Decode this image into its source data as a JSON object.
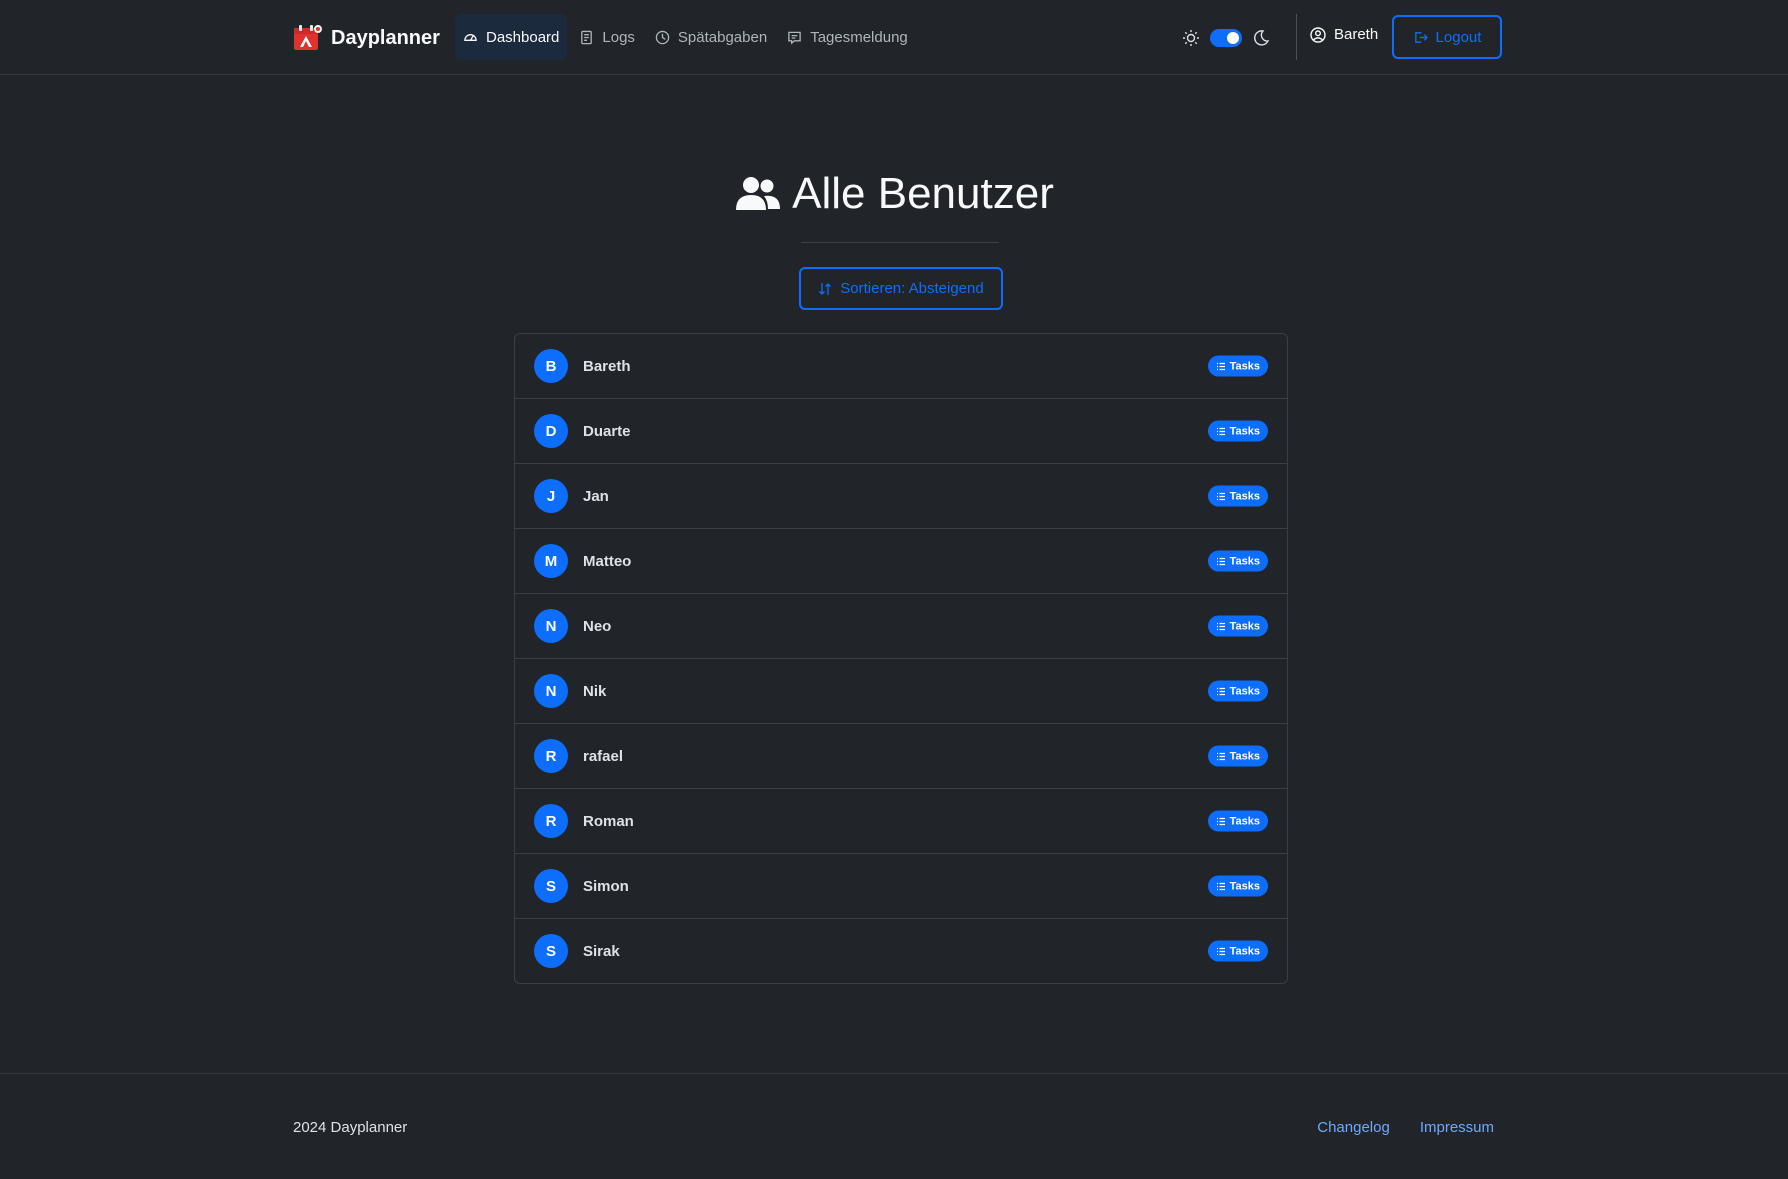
{
  "brand": {
    "name": "Dayplanner",
    "logo_icon": "calendar-logo-icon"
  },
  "nav": {
    "items": [
      {
        "label": "Dashboard",
        "icon": "speedometer-icon",
        "active": true
      },
      {
        "label": "Logs",
        "icon": "document-icon",
        "active": false
      },
      {
        "label": "Spätabgaben",
        "icon": "clock-icon",
        "active": false
      },
      {
        "label": "Tagesmeldung",
        "icon": "chat-icon",
        "active": false
      }
    ],
    "theme_dark_enabled": true,
    "user_name": "Bareth",
    "logout_label": "Logout"
  },
  "page": {
    "title": "Alle Benutzer",
    "sort_label": "Sortieren: Absteigend"
  },
  "users": [
    {
      "initial": "B",
      "name": "Bareth",
      "action": "Tasks"
    },
    {
      "initial": "D",
      "name": "Duarte",
      "action": "Tasks"
    },
    {
      "initial": "J",
      "name": "Jan",
      "action": "Tasks"
    },
    {
      "initial": "M",
      "name": "Matteo",
      "action": "Tasks"
    },
    {
      "initial": "N",
      "name": "Neo",
      "action": "Tasks"
    },
    {
      "initial": "N",
      "name": "Nik",
      "action": "Tasks"
    },
    {
      "initial": "R",
      "name": "rafael",
      "action": "Tasks"
    },
    {
      "initial": "R",
      "name": "Roman",
      "action": "Tasks"
    },
    {
      "initial": "S",
      "name": "Simon",
      "action": "Tasks"
    },
    {
      "initial": "S",
      "name": "Sirak",
      "action": "Tasks"
    }
  ],
  "footer": {
    "copyright": "2024 Dayplanner",
    "links": [
      "Changelog",
      "Impressum"
    ]
  },
  "colors": {
    "background": "#212529",
    "accent": "#0d6efd",
    "link": "#6ea8fe"
  }
}
